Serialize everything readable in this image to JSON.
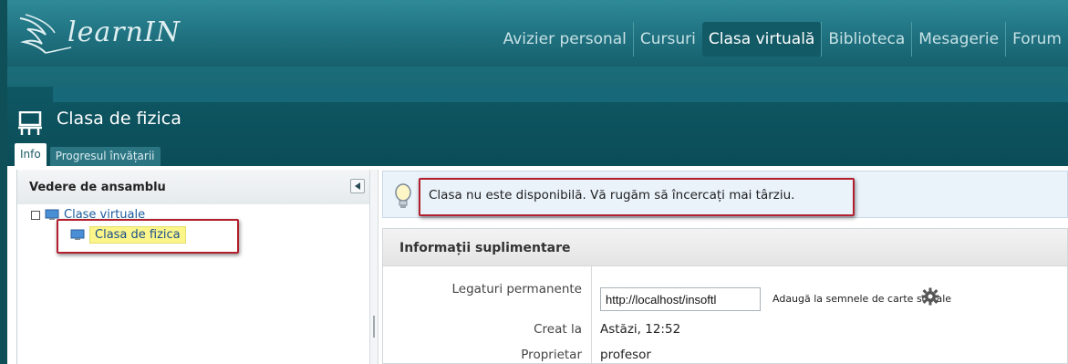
{
  "brand": {
    "logo_text": "learnIN"
  },
  "nav": {
    "items": [
      "Avizier personal",
      "Cursuri",
      "Clasa virtuală",
      "Biblioteca",
      "Mesagerie",
      "Forum"
    ],
    "active": "Clasa virtuală"
  },
  "header": {
    "title": "Clasa de fizica",
    "tabs": [
      {
        "label": "Info",
        "active": true
      },
      {
        "label": "Progresul învățarii",
        "active": false
      }
    ]
  },
  "sidebar": {
    "title": "Vedere de ansamblu",
    "tree": {
      "root_label": "Clase virtuale",
      "child_label": "Clasa de fizica"
    }
  },
  "notice": {
    "text": "Clasa nu este disponibilă. Vă rugăm să încercați mai târziu."
  },
  "info": {
    "title": "Informații suplimentare",
    "rows": [
      {
        "label": "Legaturi permanente",
        "value": "http://localhost/insoftl"
      },
      {
        "label": "Creat la",
        "value": "Astăzi, 12:52"
      },
      {
        "label": "Proprietar",
        "value": "profesor"
      }
    ],
    "social_label": "Adaugă la semnele de carte sociale"
  },
  "colors": {
    "brand": "#1f7180",
    "header_dark": "#0b4d58",
    "highlight": "#fbf58a",
    "annotation": "#b21f2d"
  }
}
